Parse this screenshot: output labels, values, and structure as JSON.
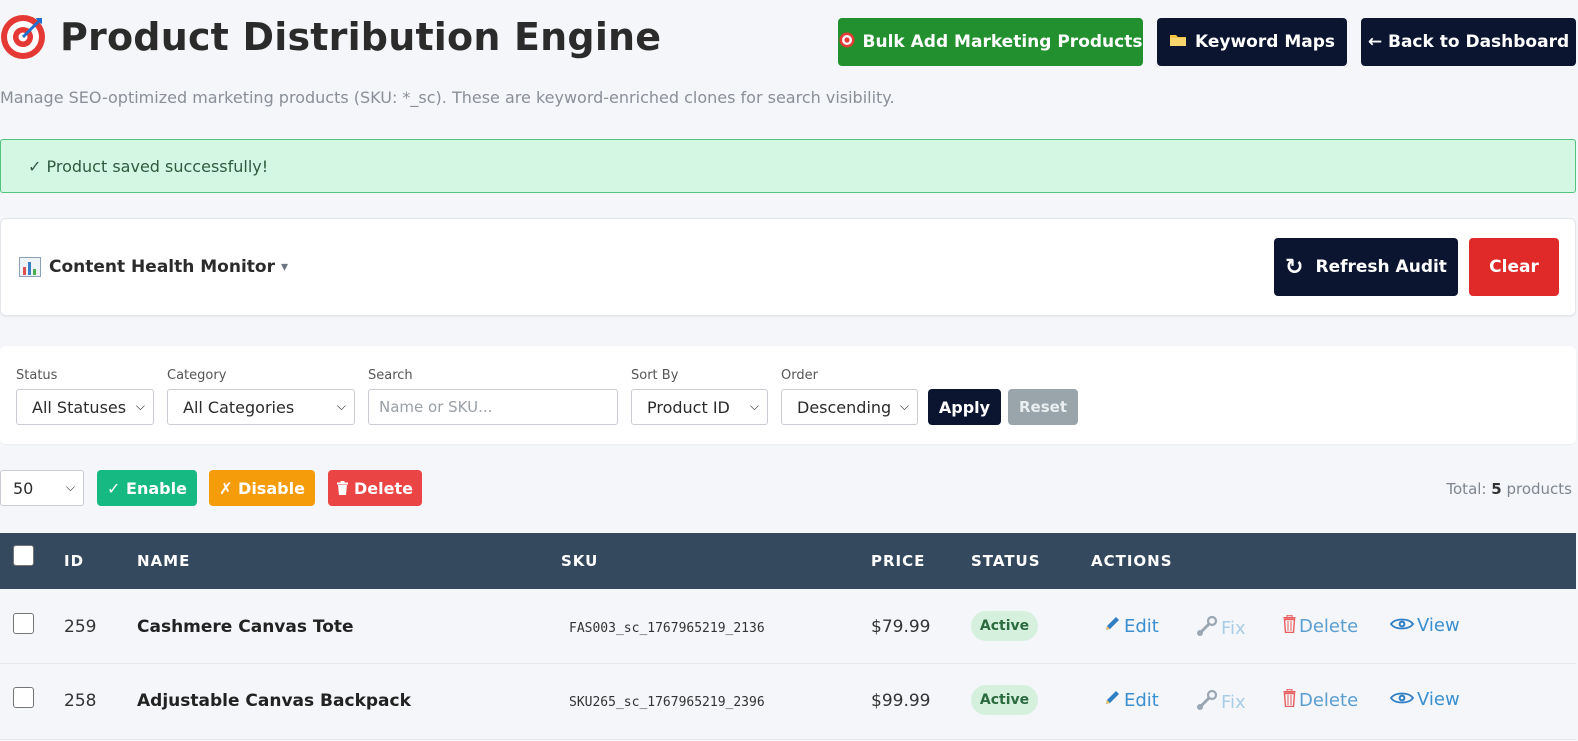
{
  "header": {
    "title": "Product Distribution Engine",
    "subtitle": "Manage SEO-optimized marketing products (SKU: *_sc). These are keyword-enriched clones for search visibility.",
    "bulk_add_label": "Bulk Add Marketing Products",
    "keyword_maps_label": "Keyword Maps",
    "back_label": "← Back to Dashboard"
  },
  "alert": {
    "message": "✓ Product saved successfully!"
  },
  "health": {
    "title": "Content Health Monitor",
    "caret": "▾",
    "refresh_label": "Refresh Audit",
    "refresh_icon": "↻",
    "clear_label": "Clear"
  },
  "filters": {
    "status_label": "Status",
    "status_value": "All Statuses",
    "category_label": "Category",
    "category_value": "All Categories",
    "search_label": "Search",
    "search_placeholder": "Name or SKU...",
    "sort_label": "Sort By",
    "sort_value": "Product ID",
    "order_label": "Order",
    "order_value": "Descending",
    "apply_label": "Apply",
    "reset_label": "Reset"
  },
  "bulk": {
    "per_page": "50",
    "enable_label": "✓ Enable",
    "disable_label": "✗ Disable",
    "delete_label": "Delete",
    "total_prefix": "Total:",
    "total_count": "5",
    "total_suffix": "products"
  },
  "table": {
    "headers": {
      "id": "ID",
      "name": "NAME",
      "sku": "SKU",
      "price": "PRICE",
      "status": "STATUS",
      "actions": "ACTIONS"
    },
    "actions": {
      "edit": "Edit",
      "fix": "Fix",
      "delete": "Delete",
      "view": "View"
    },
    "rows": [
      {
        "id": "259",
        "name": "Cashmere Canvas Tote",
        "sku": "FAS003_sc_1767965219_2136",
        "price": "$79.99",
        "status": "Active"
      },
      {
        "id": "258",
        "name": "Adjustable Canvas Backpack",
        "sku": "SKU265_sc_1767965219_2396",
        "price": "$99.99",
        "status": "Active"
      }
    ]
  },
  "colors": {
    "primary_dark": "#0b1530",
    "success_green": "#22902f",
    "danger_red": "#e02a2a",
    "table_header": "#34495e"
  }
}
